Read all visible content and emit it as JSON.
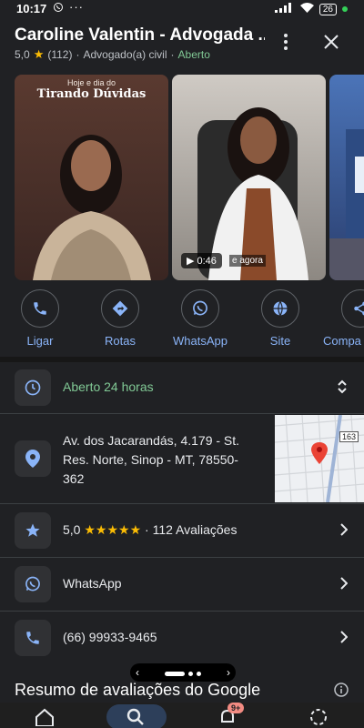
{
  "status_bar": {
    "time": "10:17",
    "more_dots": "···",
    "battery": "26"
  },
  "header": {
    "title": "Caroline Valentin - Advogada ...",
    "rating": "5,0",
    "review_count": "(112)",
    "category": "Advogado(a) civil",
    "status": "Aberto",
    "separator": "·"
  },
  "photos": {
    "photo1_caption_top": "Hoje e dia do",
    "photo1_caption_main": "Tirando Dúvidas",
    "video_duration": "0:46",
    "video_overlay_text": "e agora"
  },
  "actions": [
    {
      "label": "Ligar",
      "icon": "phone-icon"
    },
    {
      "label": "Rotas",
      "icon": "directions-icon"
    },
    {
      "label": "WhatsApp",
      "icon": "whatsapp-icon"
    },
    {
      "label": "Site",
      "icon": "globe-icon"
    },
    {
      "label": "Compa",
      "icon": "share-icon"
    }
  ],
  "details": {
    "hours": "Aberto 24 horas",
    "address_line1": "Av. dos Jacarandás, 4.179 - St.",
    "address_line2": "Res. Norte, Sinop - MT, 78550-",
    "address_line3": "362",
    "map_route_number": "163",
    "rating_value": "5,0",
    "rating_stars": "★★★★★",
    "rating_count": "112 Avaliações",
    "whatsapp": "WhatsApp",
    "phone": "(66) 99933-9465"
  },
  "reviews_section": {
    "title": "Resumo de avaliações do Google"
  },
  "bottom_nav": {
    "notification_badge": "9+"
  },
  "colors": {
    "background": "#202124",
    "accent_blue": "#8ab4f8",
    "open_green": "#81c995",
    "star_yellow": "#fbbc04"
  }
}
